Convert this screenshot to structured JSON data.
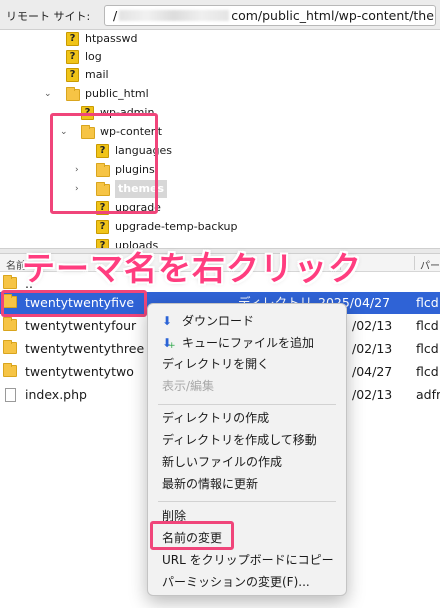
{
  "remote_site": {
    "label": "リモート サイト:",
    "path_prefix": "/",
    "path_suffix": "com/public_html/wp-content/themes"
  },
  "tree": {
    "items": [
      {
        "label": "htpasswd",
        "icon": "unknown-folder-icon"
      },
      {
        "label": "log",
        "icon": "unknown-folder-icon"
      },
      {
        "label": "mail",
        "icon": "unknown-folder-icon"
      },
      {
        "label": "public_html",
        "icon": "folder-icon"
      },
      {
        "label": "wp-admin",
        "icon": "unknown-folder-icon"
      },
      {
        "label": "wp-content",
        "icon": "folder-icon"
      },
      {
        "label": "languages",
        "icon": "unknown-folder-icon"
      },
      {
        "label": "plugins",
        "icon": "folder-icon"
      },
      {
        "label": "themes",
        "icon": "folder-icon"
      },
      {
        "label": "upgrade",
        "icon": "unknown-folder-icon"
      },
      {
        "label": "upgrade-temp-backup",
        "icon": "unknown-folder-icon"
      },
      {
        "label": "uploads",
        "icon": "unknown-folder-icon"
      }
    ]
  },
  "list_header": {
    "name": "名前",
    "col_right": "パー"
  },
  "files": [
    {
      "name": "..",
      "date": "",
      "perm": ""
    },
    {
      "name": "twentytwentyfive",
      "type": "ディレクトリ",
      "date": "2025/04/27",
      "perm": "flcd"
    },
    {
      "name": "twentytwentyfour",
      "type": "",
      "date": "/02/13",
      "perm": "flcd"
    },
    {
      "name": "twentytwentythree",
      "type": "",
      "date": "/02/13",
      "perm": "flcd"
    },
    {
      "name": "twentytwentytwo",
      "type": "",
      "date": "/04/27",
      "perm": "flcd"
    },
    {
      "name": "index.php",
      "type": "",
      "date": "/02/13",
      "perm": "adfr"
    }
  ],
  "caption": "テーマ名を右クリック",
  "context_menu": {
    "items": [
      {
        "label": "ダウンロード",
        "icon": "download-arrow-icon",
        "enabled": true
      },
      {
        "label": "キューにファイルを追加",
        "icon": "add-to-queue-icon",
        "enabled": true
      },
      {
        "label": "ディレクトリを開く",
        "enabled": true
      },
      {
        "label": "表示/編集",
        "enabled": false
      },
      {
        "label": "ディレクトリの作成",
        "enabled": true
      },
      {
        "label": "ディレクトリを作成して移動",
        "enabled": true
      },
      {
        "label": "新しいファイルの作成",
        "enabled": true
      },
      {
        "label": "最新の情報に更新",
        "enabled": true
      },
      {
        "label": "削除",
        "enabled": true
      },
      {
        "label": "名前の変更",
        "enabled": true
      },
      {
        "label": "URL をクリップボードにコピー",
        "enabled": true
      },
      {
        "label": "パーミッションの変更(F)...",
        "enabled": true
      }
    ]
  },
  "colors": {
    "highlight": "#f0457a",
    "selection": "#2f63d6",
    "caption": "#ff3d7f"
  }
}
